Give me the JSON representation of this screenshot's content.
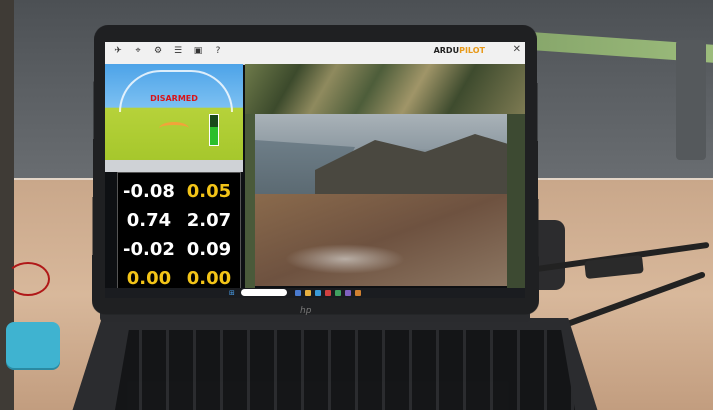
{
  "app": {
    "logo_main": "ARDU",
    "logo_accent": "PILOT",
    "close_glyph": "✕"
  },
  "menu": {
    "icons": [
      "flight-data-icon",
      "flight-plan-icon",
      "setup-icon",
      "config-icon",
      "simulation-icon",
      "help-icon"
    ],
    "glyphs": [
      "✈",
      "⌖",
      "⚙",
      "☰",
      "▣",
      "?"
    ]
  },
  "hud": {
    "status": "DISARMED",
    "message": "",
    "battery_level": 0.6,
    "sky_color": "#4da3e8",
    "ground_color": "#b6d23a",
    "status_color": "#d9141a"
  },
  "quick": {
    "values": [
      {
        "value": "-0.08",
        "color": "#ffffff"
      },
      {
        "value": "0.05",
        "color": "#f3c418"
      },
      {
        "value": "0.74",
        "color": "#ffffff"
      },
      {
        "value": "2.07",
        "color": "#ffffff"
      },
      {
        "value": "-0.02",
        "color": "#ffffff"
      },
      {
        "value": "0.09",
        "color": "#ffffff"
      },
      {
        "value": "0.00",
        "color": "#f3c418"
      },
      {
        "value": "0.00",
        "color": "#f3c418"
      }
    ]
  },
  "taskbar": {
    "start_glyph": "⊞"
  },
  "device": {
    "brand_glyph": "hp"
  },
  "colors": {
    "accessory": "#3fb3d0",
    "map_green": "#3c4a2c"
  }
}
